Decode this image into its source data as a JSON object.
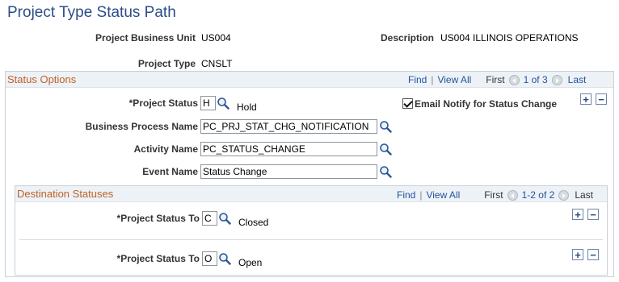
{
  "page": {
    "title": "Project Type Status Path"
  },
  "header": {
    "business_unit_label": "Project Business Unit",
    "business_unit_value": "US004",
    "description_label": "Description",
    "description_value": "US004 ILLINOIS OPERATIONS",
    "project_type_label": "Project Type",
    "project_type_value": "CNSLT"
  },
  "status_options": {
    "title": "Status Options",
    "nav": {
      "find": "Find",
      "separator": "|",
      "view_all": "View All",
      "first": "First",
      "count": "1 of 3",
      "last": "Last"
    },
    "project_status_label": "*Project Status",
    "project_status_value": "H",
    "project_status_desc": "Hold",
    "email_notify_label": "Email Notify for Status Change",
    "email_notify_checked": true,
    "business_process_label": "Business Process Name",
    "business_process_value": "PC_PRJ_STAT_CHG_NOTIFICATION",
    "activity_label": "Activity Name",
    "activity_value": "PC_STATUS_CHANGE",
    "event_label": "Event Name",
    "event_value": "Status Change",
    "add_symbol": "+",
    "remove_symbol": "−"
  },
  "destination_statuses": {
    "title": "Destination Statuses",
    "nav": {
      "find": "Find",
      "separator": "|",
      "view_all": "View All",
      "first": "First",
      "count": "1-2 of 2",
      "last": "Last"
    },
    "rows": [
      {
        "label": "*Project Status To",
        "value": "C",
        "desc": "Closed"
      },
      {
        "label": "*Project Status To",
        "value": "O",
        "desc": "Open"
      }
    ],
    "add_symbol": "+",
    "remove_symbol": "−"
  },
  "icons": {
    "lookup": "magnifier-icon",
    "nav_prev": "left-arrow-icon",
    "nav_next": "right-arrow-icon"
  },
  "colors": {
    "title": "#2d4d86",
    "section_title": "#c06026",
    "link": "#2352a0",
    "section_header_bg": "#edf2f6"
  }
}
